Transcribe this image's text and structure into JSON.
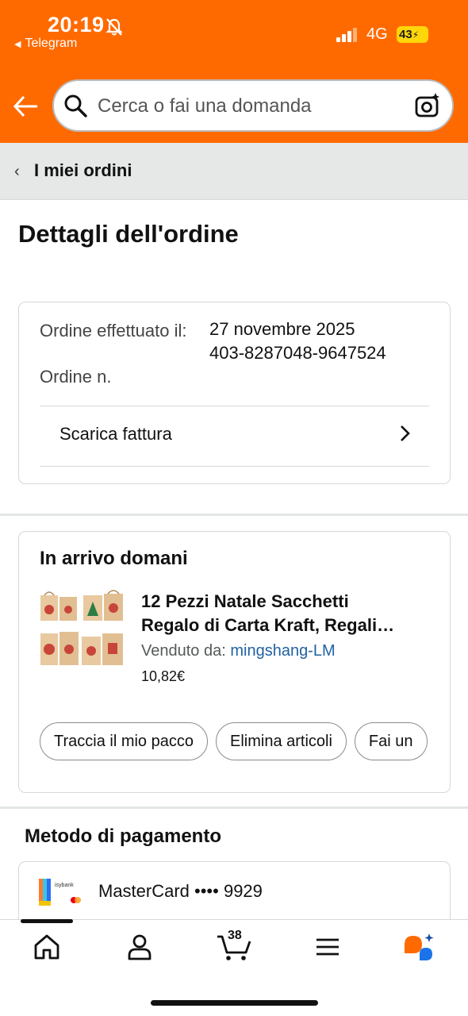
{
  "status": {
    "time": "20:19",
    "back_app": "Telegram",
    "network": "4G",
    "battery": "43"
  },
  "search": {
    "placeholder": "Cerca o fai una domanda"
  },
  "breadcrumb": {
    "label": "I miei ordini"
  },
  "page": {
    "title": "Dettagli dell'ordine"
  },
  "order": {
    "placed_label": "Ordine effettuato il:",
    "placed_value": "27 novembre 2025",
    "number_label": "Ordine n.",
    "number_value": "403-8287048-9647524",
    "invoice_label": "Scarica fattura"
  },
  "delivery": {
    "title": "In arrivo domani",
    "product_title_line1": "12 Pezzi Natale Sacchetti",
    "product_title_line2": "Regalo di Carta Kraft, Regali…",
    "seller_prefix": "Venduto da:",
    "seller_name": "mingshang-LM",
    "price": "10,82€",
    "actions": [
      "Traccia il mio pacco",
      "Elimina articoli",
      "Fai un"
    ]
  },
  "payment": {
    "title": "Metodo di pagamento",
    "card_label": "MasterCard •••• 9929",
    "bank_logo_text": "isybank"
  },
  "nav": {
    "cart_count": "38",
    "items": [
      "home-icon",
      "account-icon",
      "cart-icon",
      "menu-icon",
      "assistant-icon"
    ]
  },
  "colors": {
    "header": "#ff6a00",
    "link": "#2162a1",
    "breadcrumb_bg": "#e6e7e7"
  }
}
